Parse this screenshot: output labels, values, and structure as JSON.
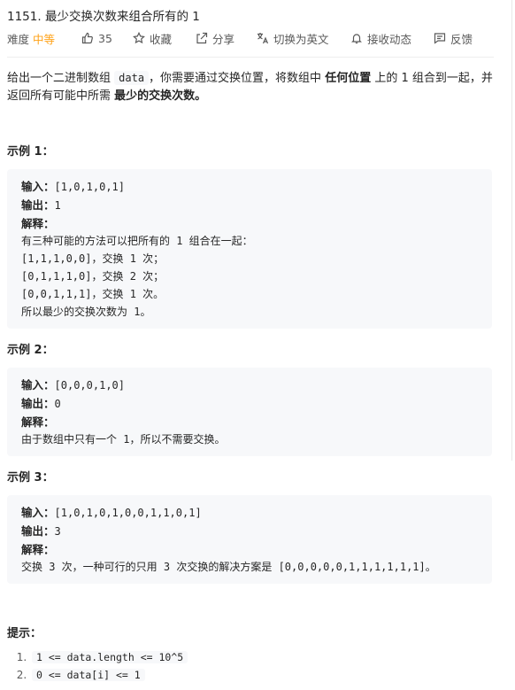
{
  "problem": {
    "title": "1151. 最少交换次数来组合所有的 1"
  },
  "toolbar": {
    "difficulty_label": "难度",
    "difficulty_value": "中等",
    "likes": "35",
    "favorite": "收藏",
    "share": "分享",
    "switch_lang": "切换为英文",
    "notifications": "接收动态",
    "feedback": "反馈"
  },
  "icons": {
    "like": "thumbs-up-icon",
    "favorite": "star-icon",
    "share": "share-icon",
    "translate": "translate-icon",
    "bell": "bell-icon",
    "feedback": "comment-icon"
  },
  "colors": {
    "difficulty": "#ffa116",
    "code_bg": "#f7f8fa"
  },
  "description": {
    "part1": "给出一个二进制数组 ",
    "code": "data",
    "part2": "，你需要通过交换位置，将数组中 ",
    "bold1": "任何位置",
    "part3": " 上的 1 组合到一起，并返回所有可能中所需 ",
    "bold2": "最少的交换次数。"
  },
  "examples": [
    {
      "heading": "示例 1：",
      "input_label": "输入：",
      "input": "[1,0,1,0,1]",
      "output_label": "输出：",
      "output": "1",
      "explain_label": "解释：",
      "explanation": [
        "有三种可能的方法可以把所有的 1 组合在一起：",
        "[1,1,1,0,0]，交换 1 次；",
        "[0,1,1,1,0]，交换 2 次；",
        "[0,0,1,1,1]，交换 1 次。",
        "所以最少的交换次数为 1。"
      ]
    },
    {
      "heading": "示例 2：",
      "input_label": "输入：",
      "input": "[0,0,0,1,0]",
      "output_label": "输出：",
      "output": "0",
      "explain_label": "解释：",
      "explanation": [
        "由于数组中只有一个 1，所以不需要交换。"
      ]
    },
    {
      "heading": "示例 3：",
      "input_label": "输入：",
      "input": "[1,0,1,0,1,0,0,1,1,0,1]",
      "output_label": "输出：",
      "output": "3",
      "explain_label": "解释：",
      "explanation": [
        "交换 3 次，一种可行的只用 3 次交换的解决方案是 [0,0,0,0,0,1,1,1,1,1,1]。"
      ]
    }
  ],
  "hints": {
    "heading": "提示：",
    "items": [
      "1 <= data.length <= 10^5",
      "0 <= data[i] <= 1"
    ]
  }
}
